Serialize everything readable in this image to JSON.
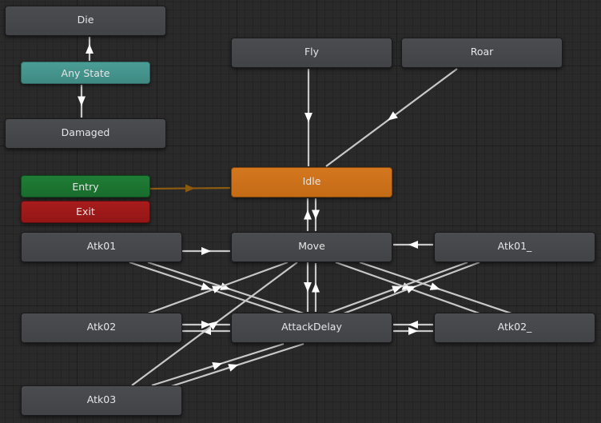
{
  "graph": {
    "states": {
      "die": "Die",
      "any_state": "Any State",
      "damaged": "Damaged",
      "entry": "Entry",
      "exit": "Exit",
      "fly": "Fly",
      "roar": "Roar",
      "idle": "Idle",
      "move": "Move",
      "attack_delay": "AttackDelay",
      "atk01": "Atk01",
      "atk02": "Atk02",
      "atk03": "Atk03",
      "atk01_": "Atk01_",
      "atk02_": "Atk02_"
    },
    "default_state": "Idle",
    "colors": {
      "default_state": "#d4771f",
      "any_state": "#4a9d95",
      "entry": "#1f7d35",
      "exit": "#a81c1c",
      "state": "#46474b",
      "transition": "#c8c8c8",
      "default_transition": "#8a5a10"
    }
  }
}
